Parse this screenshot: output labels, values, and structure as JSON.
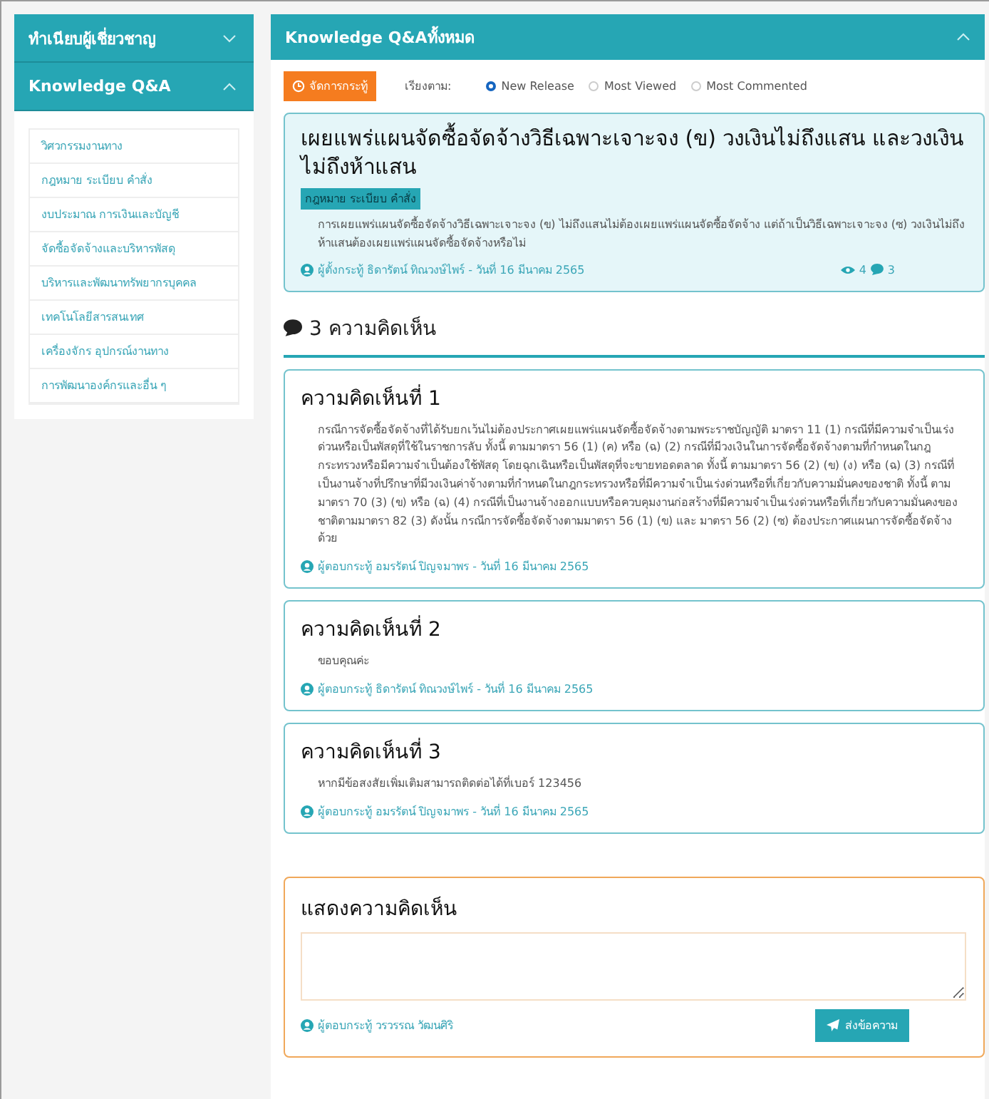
{
  "sidebar": {
    "sections": [
      {
        "title": "ทำเนียบผู้เชี่ยวชาญ",
        "expanded": false
      },
      {
        "title": "Knowledge Q&A",
        "expanded": true,
        "items": [
          "วิศวกรรมงานทาง",
          "กฎหมาย ระเบียบ คำสั่ง",
          "งบประมาณ การเงินและบัญชี",
          "จัดซื้อจัดจ้างและบริหารพัสดุ",
          "บริหารและพัฒนาทรัพยากรบุคคล",
          "เทคโนโลยีสารสนเทศ",
          "เครื่องจักร อุปกรณ์งานทาง",
          "การพัฒนาองค์กรและอื่น ๆ"
        ]
      }
    ]
  },
  "panel": {
    "title": "Knowledge Q&Aทั้งหมด",
    "expanded": true
  },
  "toolbar": {
    "manage_button": "จัดการกระทู้",
    "sort_label": "เรียงตาม:",
    "sort_options": [
      {
        "label": "New Release",
        "selected": true
      },
      {
        "label": "Most Viewed",
        "selected": false
      },
      {
        "label": "Most Commented",
        "selected": false
      }
    ]
  },
  "topic": {
    "title": "เผยแพร่แผนจัดซื้อจัดจ้างวิธีเฉพาะเจาะจง (ข) วงเงินไม่ถึงแสน และวงเงินไม่ถึงห้าแสน",
    "tag": "กฎหมาย ระเบียบ คำสั่ง",
    "body": "การเผยแพร่แผนจัดซื้อจัดจ้างวิธีเฉพาะเจาะจง (ข) ไม่ถึงแสนไม่ต้องเผยแพร่แผนจัดซื้อจัดจ้าง แต่ถ้าเป็นวิธีเฉพาะเจาะจง (ซ) วงเงินไม่ถึงห้าแสนต้องเผยแพร่แผนจัดซื้อจัดจ้างหรือไม่",
    "meta": "ผู้ตั้งกระทู้ ธิดารัตน์ ทิณวงษ์ไพร์ - วันที่ 16 มีนาคม 2565",
    "views": "4",
    "comments": "3"
  },
  "comments_heading": "3 ความคิดเห็น",
  "comments": [
    {
      "title": "ความคิดเห็นที่ 1",
      "body": "กรณีการจัดซื้อจัดจ้างที่ได้รับยกเว้นไม่ต้องประกาศเผยแพร่แผนจัดซื้อจัดจ้างตามพระราชบัญญัติ มาตรา 11 (1) กรณีที่มีความจำเป็นเร่งด่วนหรือเป็นพัสดุที่ใช้ในราชการลับ ทั้งนี้ ตามมาตรา 56 (1) (ค) หรือ (ฉ) (2) กรณีที่มีวงเงินในการจัดซื้อจัดจ้างตามที่กำหนดในกฎกระทรวงหรือมีความจำเป็นต้องใช้พัสดุ โดยฉุกเฉินหรือเป็นพัสดุที่จะขายทอดตลาด ทั้งนี้ ตามมาตรา 56 (2) (ข) (ง) หรือ (ฉ) (3) กรณีที่เป็นงานจ้างที่ปรึกษาที่มีวงเงินค่าจ้างตามที่กำหนดในกฎกระทรวงหรือที่มีความจำเป็นเร่งด่วนหรือที่เกี่ยวกับความมั่นคงของชาติ ทั้งนี้ ตามมาตรา 70 (3) (ข) หรือ (ฉ) (4) กรณีที่เป็นงานจ้างออกแบบหรือควบคุมงานก่อสร้างที่มีความจำเป็นเร่งด่วนหรือที่เกี่ยวกับความมั่นคงของชาติตามมาตรา 82 (3) ดังนั้น กรณีการจัดซื้อจัดจ้างตามมาตรา 56 (1) (ข) และ มาตรา 56 (2) (ซ) ต้องประกาศแผนการจัดซื้อจัดจ้างด้วย",
      "meta": "ผู้ตอบกระทู้ อมรรัตน์ ปิญจมาพร - วันที่ 16 มีนาคม 2565"
    },
    {
      "title": "ความคิดเห็นที่ 2",
      "body": "ขอบคุณค่ะ",
      "meta": "ผู้ตอบกระทู้ ธิดารัตน์ ทิณวงษ์ไพร์ - วันที่ 16 มีนาคม 2565"
    },
    {
      "title": "ความคิดเห็นที่ 3",
      "body": "หากมีข้อสงสัยเพิ่มเติมสามารถติดต่อได้ที่เบอร์ 123456",
      "meta": "ผู้ตอบกระทู้ อมรรัตน์ ปิญจมาพร - วันที่ 16 มีนาคม 2565"
    }
  ],
  "reply_form": {
    "title": "แสดงความคิดเห็น",
    "author": "ผู้ตอบกระทู้ วรวรรณ วัฒนศิริ",
    "submit": "ส่งข้อความ"
  }
}
